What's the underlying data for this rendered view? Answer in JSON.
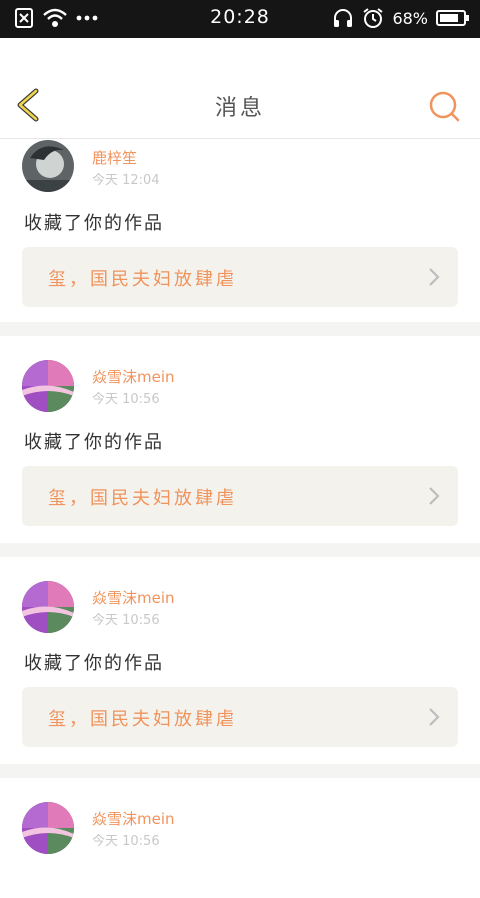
{
  "status_bar": {
    "time": "20:28",
    "battery_percent": "68%",
    "icons": [
      "sim-off-icon",
      "wifi-icon",
      "more-dots-icon",
      "headset-icon",
      "alarm-icon",
      "battery-icon"
    ]
  },
  "header": {
    "title": "消息",
    "back_icon": "chevron-left-icon",
    "search_icon": "search-icon",
    "accent_color": "#f0935c"
  },
  "notifications": [
    {
      "user": "鹿梓笙",
      "time": "今天 12:04",
      "action": "收藏了你的作品",
      "work_title": "玺，国民夫妇放肆虐",
      "avatar": "avatar-gray"
    },
    {
      "user": "焱雪沫mein",
      "time": "今天 10:56",
      "action": "收藏了你的作品",
      "work_title": "玺，国民夫妇放肆虐",
      "avatar": "avatar-purple"
    },
    {
      "user": "焱雪沫mein",
      "time": "今天 10:56",
      "action": "收藏了你的作品",
      "work_title": "玺，国民夫妇放肆虐",
      "avatar": "avatar-purple"
    },
    {
      "user": "焱雪沫mein",
      "time": "今天 10:56",
      "action": "",
      "work_title": "",
      "avatar": "avatar-purple"
    }
  ]
}
